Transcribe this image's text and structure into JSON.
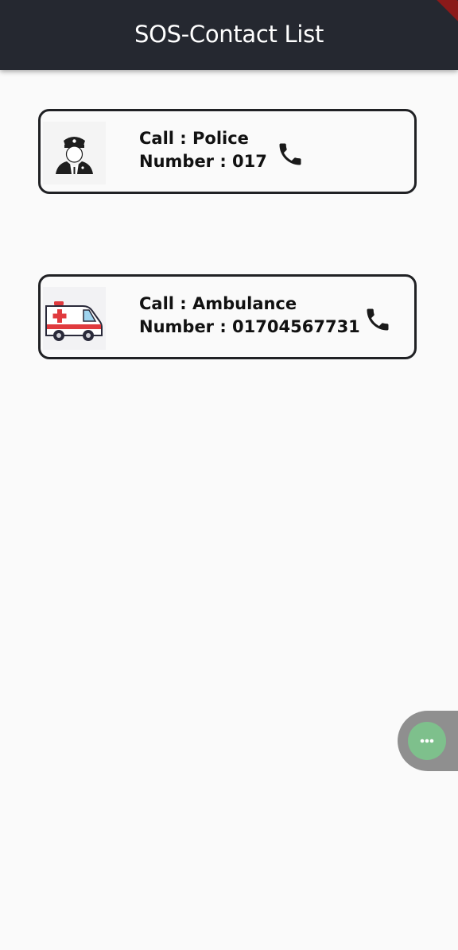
{
  "app_bar": {
    "title": "SOS-Contact List",
    "background": "#252830"
  },
  "contacts": [
    {
      "icon": "police-officer-icon",
      "call_text": "Call : Police",
      "number_text": "Number : 017",
      "action_icon": "phone-icon"
    },
    {
      "icon": "ambulance-icon",
      "call_text": "Call : Ambulance",
      "number_text": "Number : 01704567731",
      "action_icon": "phone-icon"
    }
  ],
  "floating_button": {
    "icon": "more-horizontal-icon",
    "color": "#7ec08c"
  }
}
